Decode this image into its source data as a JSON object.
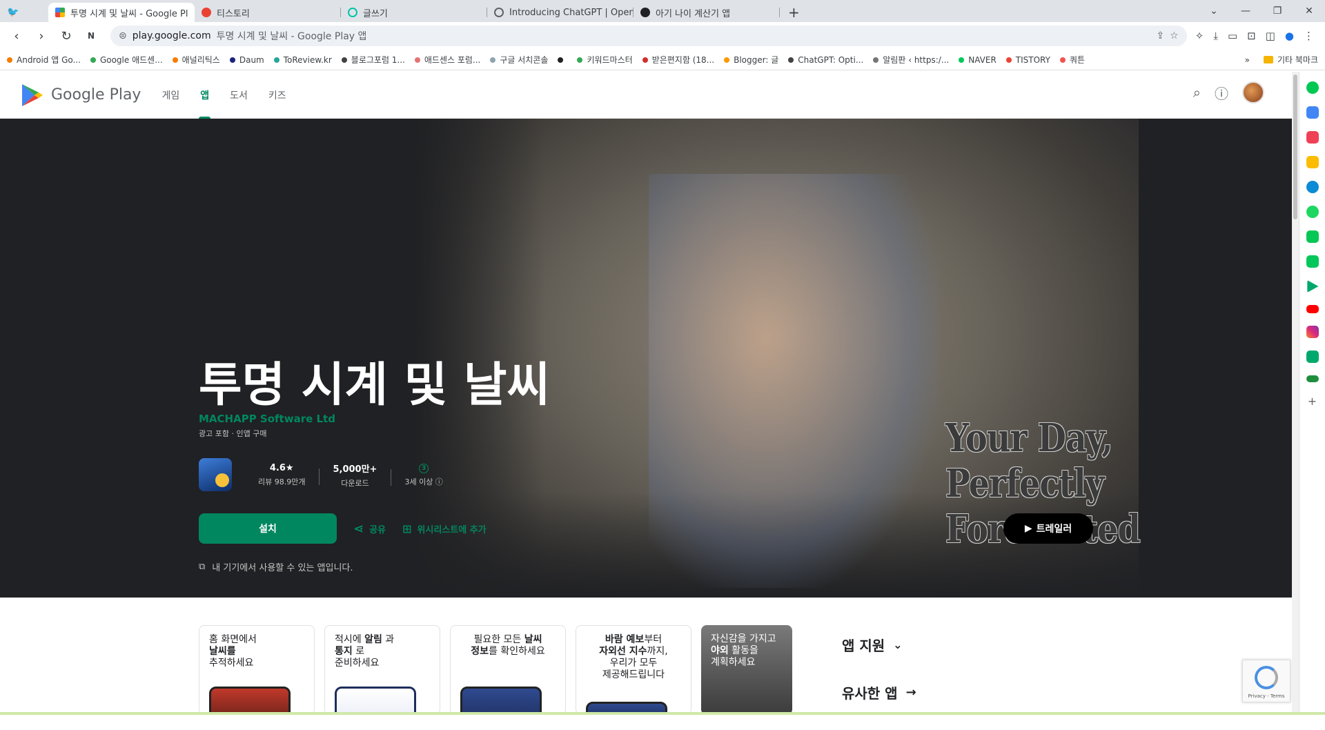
{
  "browser": {
    "tabs": [
      {
        "title": "투명 시계 및 날씨 - Google Pl",
        "color": "#34a853",
        "active": true
      },
      {
        "title": "티스토리",
        "color": "#ea4335",
        "active": false
      },
      {
        "title": "글쓰기",
        "color": "#00c4a7",
        "active": false
      },
      {
        "title": "Introducing ChatGPT | OpenA",
        "color": "#5f6368",
        "active": false
      },
      {
        "title": "아기 나이 계산기 앱",
        "color": "#202124",
        "active": false
      }
    ],
    "new_tab": "+",
    "url_host": "play.google.com",
    "url_rest": "투명 시계 및 날씨 - Google Play 앱",
    "bookmarks": [
      {
        "label": "Android 앱 Go...",
        "color": "#f57c00"
      },
      {
        "label": "Google 애드센...",
        "color": "#34a853"
      },
      {
        "label": "애널리틱스",
        "color": "#f57c00"
      },
      {
        "label": "Daum",
        "color": "#1a237e"
      },
      {
        "label": "ToReview.kr",
        "color": "#26a69a"
      },
      {
        "label": "블로그포럼 1...",
        "color": "#424242"
      },
      {
        "label": "애드센스 포럼...",
        "color": "#e57373"
      },
      {
        "label": "구글 서치콘솔",
        "color": "#90a4ae"
      },
      {
        "label": "",
        "color": "#212121"
      },
      {
        "label": "키워드마스터",
        "color": "#34a853"
      },
      {
        "label": "받은편지함 (18...",
        "color": "#d32f2f"
      },
      {
        "label": "Blogger: 글",
        "color": "#ff9800"
      },
      {
        "label": "ChatGPT: Opti...",
        "color": "#424242"
      },
      {
        "label": "알림판 ‹ https:/...",
        "color": "#757575"
      },
      {
        "label": "NAVER",
        "color": "#03c75a"
      },
      {
        "label": "TISTORY",
        "color": "#ea4335"
      },
      {
        "label": "쿼튼",
        "color": "#ef5350"
      }
    ],
    "bookmarks_more": "»",
    "other_bookmarks": "기타 북마크"
  },
  "store": {
    "brand": "Google Play",
    "nav": [
      {
        "label": "게임",
        "active": false
      },
      {
        "label": "앱",
        "active": true
      },
      {
        "label": "도서",
        "active": false
      },
      {
        "label": "키즈",
        "active": false
      }
    ]
  },
  "app": {
    "title": "투명 시계 및 날씨",
    "developer": "MACHAPP Software Ltd",
    "sub": "광고 포함 · 인앱 구매",
    "rating": "4.6★",
    "reviews": "리뷰 98.9만개",
    "downloads": "5,000만+",
    "downloads_label": "다운로드",
    "age_badge": "3",
    "age": "3세 이상 ⓘ",
    "install": "설치",
    "share": "공유",
    "wishlist": "위시리스트에 추가",
    "device_note": "내 기기에서 사용할 수 있는 앱입니다.",
    "trailer": "트레일러",
    "tagline": "Your Day, Perfectly Forecasted"
  },
  "screenshots": [
    {
      "line1": "홈 화면에서",
      "bold": "날씨를",
      "line3": "추적하세요"
    },
    {
      "line1_pre": "적시에 ",
      "line1_b": "알림",
      "line1_post": " 과",
      "line2_b": "통지",
      "line2_post": " 로",
      "line3": "준비하세요"
    },
    {
      "l1_pre": "필요한 모든 ",
      "l1_b": "날씨",
      "l2_b": "정보",
      "l2_post": "를 확인하세요"
    },
    {
      "l1_b": "바람 예보",
      "l1_post": "부터",
      "l2_b": "자외선 지수",
      "l2_post": "까지,",
      "l3": "우리가 모두",
      "l4": "제공해드립니다"
    },
    {
      "l1": "자신감을 가지고",
      "l2_b": "야외",
      "l2_post": " 활동을",
      "l3": "계획하세요"
    }
  ],
  "side": {
    "support": "앱 지원",
    "similar": "유사한 앱"
  },
  "recaptcha": "Privacy - Terms"
}
